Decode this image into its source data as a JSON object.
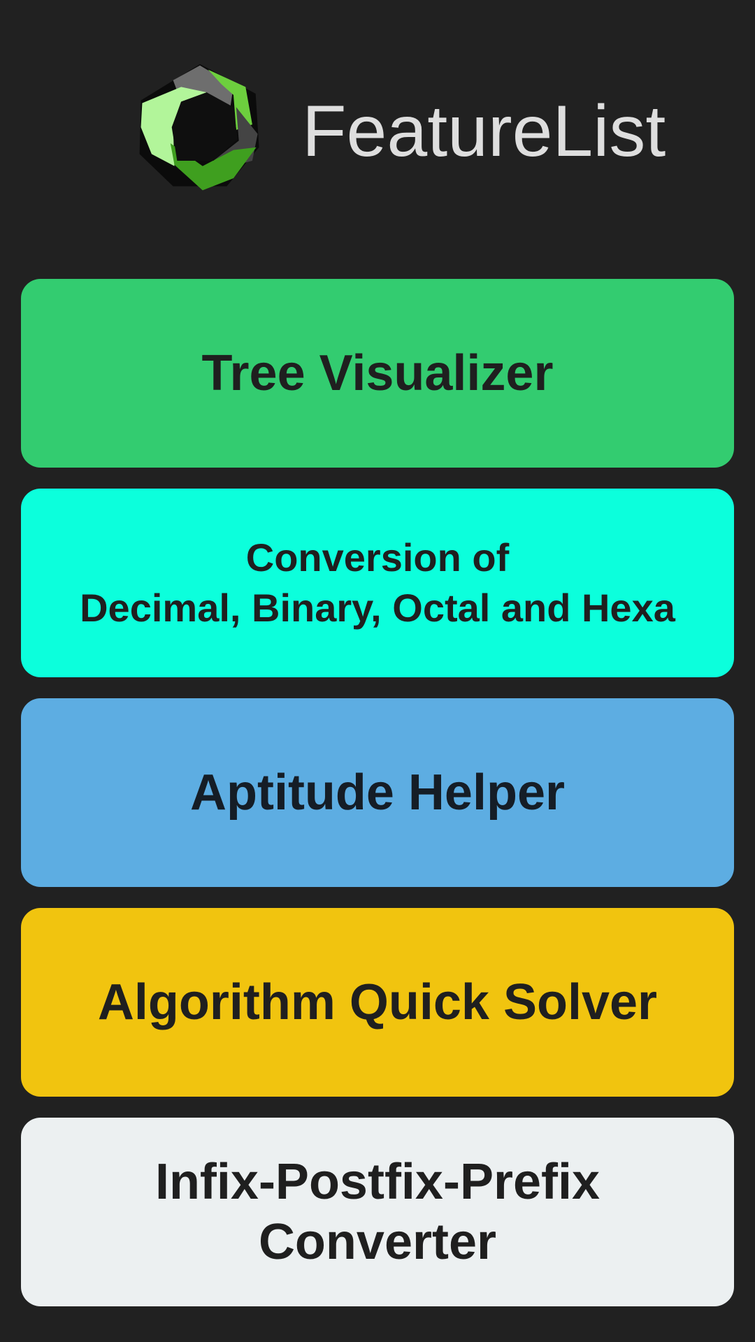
{
  "header": {
    "title": "FeatureList",
    "logo_icon": "hexagon-cycle-logo-icon"
  },
  "features": [
    {
      "label": "Tree Visualizer",
      "color": "#33cc70"
    },
    {
      "label": "Conversion of\nDecimal, Binary, Octal and Hexa",
      "color": "#0cffdc"
    },
    {
      "label": "Aptitude Helper",
      "color": "#5dade2"
    },
    {
      "label": "Algorithm Quick Solver",
      "color": "#f1c40f"
    },
    {
      "label": "Infix-Postfix-Prefix\nConverter",
      "color": "#ecf0f1"
    }
  ],
  "colors": {
    "background": "#212121",
    "title_text": "#dedede",
    "button_text": "#1f1f1f"
  }
}
